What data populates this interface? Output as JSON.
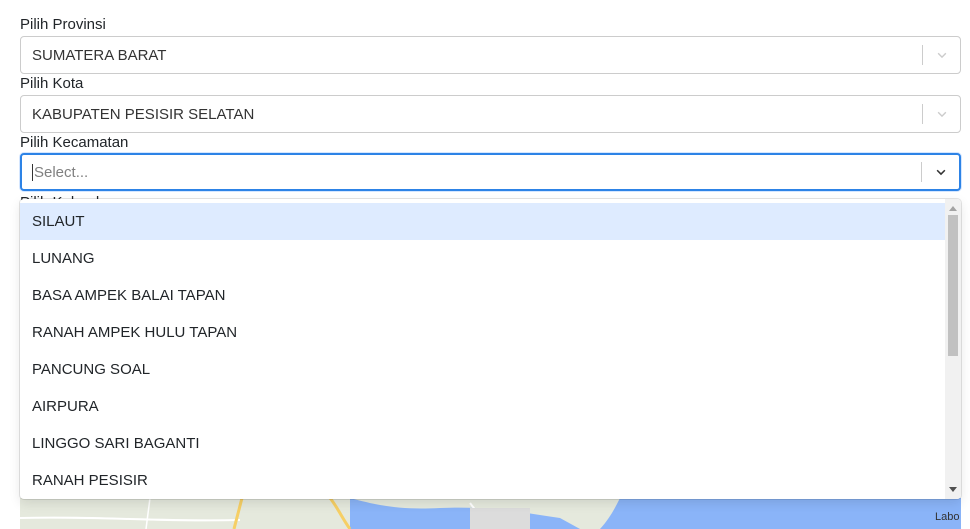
{
  "provinsi": {
    "label": "Pilih Provinsi",
    "value": "SUMATERA BARAT"
  },
  "kota": {
    "label": "Pilih Kota",
    "value": "KABUPATEN PESISIR SELATAN"
  },
  "kecamatan": {
    "label": "Pilih Kecamatan",
    "placeholder": "Select...",
    "options": [
      "SILAUT",
      "LUNANG",
      "BASA AMPEK BALAI TAPAN",
      "RANAH AMPEK HULU TAPAN",
      "PANCUNG SOAL",
      "AIRPURA",
      "LINGGO SARI BAGANTI",
      "RANAH PESISIR"
    ],
    "highlighted_option": "SILAUT"
  },
  "kelurahan": {
    "label": "Pilih Kelurahan"
  },
  "map": {
    "attribution": "Labo"
  },
  "icons": {
    "dropdown": "chevron-down-icon",
    "scroll_up": "scroll-up-arrow-icon",
    "scroll_down": "scroll-down-arrow-icon"
  },
  "colors": {
    "focus_border": "#2684ff",
    "highlight": "#deebff",
    "border": "#cccccc"
  }
}
